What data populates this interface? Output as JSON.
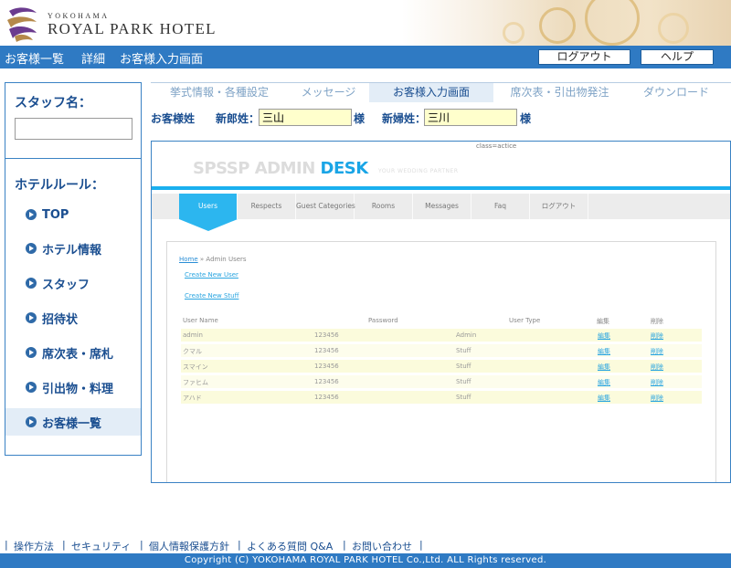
{
  "brand": {
    "top": "YOKOHAMA",
    "main": "ROYAL PARK HOTEL"
  },
  "navbar": {
    "crumbs": [
      "お客様一覧",
      "詳細",
      "お客様入力画面"
    ],
    "logout_label": "ログアウト",
    "help_label": "ヘルプ"
  },
  "sidebar": {
    "staff_title": "スタッフ名：",
    "staff_value": "",
    "rules_title": "ホテルルール：",
    "items": [
      {
        "label": "TOP"
      },
      {
        "label": "ホテル情報"
      },
      {
        "label": "スタッフ"
      },
      {
        "label": "招待状"
      },
      {
        "label": "席次表・席札"
      },
      {
        "label": "引出物・料理"
      },
      {
        "label": "お客様一覧"
      }
    ]
  },
  "tabs": [
    "挙式情報・各種設定",
    "メッセージ",
    "お客様入力画面",
    "席次表・引出物発注",
    "ダウンロード"
  ],
  "guest": {
    "label": "お客様姓",
    "groom_label": "新郎姓：",
    "groom_value": "三山",
    "groom_suffix": "様",
    "bride_label": "新婦姓：",
    "bride_value": "三川",
    "bride_suffix": "様"
  },
  "admin": {
    "class_note": "class=actice",
    "logo_gray": "SPSSP ADMIN ",
    "logo_blue": "DESK",
    "logo_sub": "YOUR WEDDING PARTNER",
    "menu": [
      "Users",
      "Respects",
      "Guest Categories",
      "Rooms",
      "Messages",
      "Faq",
      "ログアウト"
    ],
    "breadcrumb_home": "Home",
    "breadcrumb_rest": " » Admin Users",
    "create_user": "Create New User",
    "create_stuff": "Create New Stuff",
    "columns": [
      "User Name",
      "Password",
      "User Type",
      "編集",
      "削除"
    ],
    "rows": [
      {
        "name": "admin",
        "password": "123456",
        "type": "Admin",
        "edit": "編集",
        "delete": "削除"
      },
      {
        "name": "クマル",
        "password": "123456",
        "type": "Stuff",
        "edit": "編集",
        "delete": "削除"
      },
      {
        "name": "スマイン",
        "password": "123456",
        "type": "Stuff",
        "edit": "編集",
        "delete": "削除"
      },
      {
        "name": "ファヒム",
        "password": "123456",
        "type": "Stuff",
        "edit": "編集",
        "delete": "削除"
      },
      {
        "name": "アハド",
        "password": "123456",
        "type": "Stuff",
        "edit": "編集",
        "delete": "削除"
      }
    ]
  },
  "footer": {
    "links": [
      "操作方法",
      "セキュリティ",
      "個人情報保護方針",
      "よくある質問 Q&A",
      "お問い合わせ"
    ],
    "copyright": "Copyright (C) YOKOHAMA ROYAL PARK HOTEL Co.,Ltd. ALL Rights reserved."
  },
  "colors": {
    "primary": "#2f7ac3",
    "accent": "#1ab0ef",
    "highlight": "#ffffcc"
  }
}
